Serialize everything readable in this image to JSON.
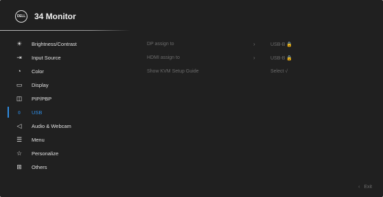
{
  "header": {
    "logo_text": "DELL",
    "model": "34 Monitor"
  },
  "menu": {
    "items": [
      {
        "label": "Brightness/Contrast",
        "icon": "brightness-icon",
        "glyph": "☀",
        "active": false
      },
      {
        "label": "Input Source",
        "icon": "input-source-icon",
        "glyph": "⇥",
        "active": false
      },
      {
        "label": "Color",
        "icon": "color-palette-icon",
        "glyph": "◔",
        "active": false
      },
      {
        "label": "Display",
        "icon": "display-icon",
        "glyph": "▭",
        "active": false
      },
      {
        "label": "PIP/PBP",
        "icon": "pip-pbp-icon",
        "glyph": "◫",
        "active": false
      },
      {
        "label": "USB",
        "icon": "usb-mouse-icon",
        "glyph": "⌽",
        "active": true
      },
      {
        "label": "Audio & Webcam",
        "icon": "audio-webcam-icon",
        "glyph": "◁",
        "active": false
      },
      {
        "label": "Menu",
        "icon": "menu-icon",
        "glyph": "☰",
        "active": false
      },
      {
        "label": "Personalize",
        "icon": "star-icon",
        "glyph": "☆",
        "active": false
      },
      {
        "label": "Others",
        "icon": "others-icon",
        "glyph": "⊞",
        "active": false
      }
    ]
  },
  "submenu": {
    "rows": [
      {
        "label": "DP assign to",
        "arrow": "›",
        "value": "USB-B 🔒"
      },
      {
        "label": "HDMI assign to",
        "arrow": "›",
        "value": "USB-B 🔒"
      },
      {
        "label": "Show KVM Setup Guide",
        "arrow": "",
        "value": "Select √"
      }
    ]
  },
  "footer": {
    "exit_chevron": "‹",
    "exit_label": "Exit"
  },
  "colors": {
    "background": "#202020",
    "accent": "#2f8de4",
    "disabled_text": "#6c6c6c"
  }
}
